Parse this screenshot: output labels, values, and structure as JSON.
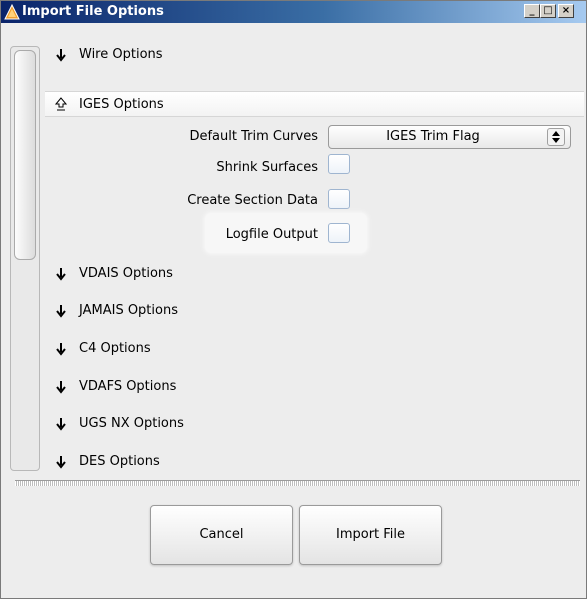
{
  "window": {
    "title": "Import File Options",
    "minimize_glyph": "_",
    "maximize_glyph": "□",
    "close_glyph": "×"
  },
  "sections": [
    {
      "label": "Wire Options",
      "expanded": false
    },
    {
      "label": "IGES Options",
      "expanded": true
    },
    {
      "label": "VDAIS Options",
      "expanded": false
    },
    {
      "label": "JAMAIS Options",
      "expanded": false
    },
    {
      "label": "C4 Options",
      "expanded": false
    },
    {
      "label": "VDAFS Options",
      "expanded": false
    },
    {
      "label": "UGS NX Options",
      "expanded": false
    },
    {
      "label": "DES Options",
      "expanded": false
    }
  ],
  "iges_options": {
    "default_trim_curves_label": "Default Trim Curves",
    "default_trim_curves_value": "IGES Trim Flag",
    "shrink_surfaces_label": "Shrink Surfaces",
    "shrink_surfaces_checked": false,
    "create_section_data_label": "Create Section Data",
    "create_section_data_checked": false,
    "logfile_output_label": "Logfile Output",
    "logfile_output_checked": false
  },
  "icons": {
    "collapsed_arrow": "🡇",
    "expanded_arrow": "⇪",
    "select_arrow": "▲▼"
  },
  "buttons": {
    "cancel": "Cancel",
    "import": "Import File"
  }
}
